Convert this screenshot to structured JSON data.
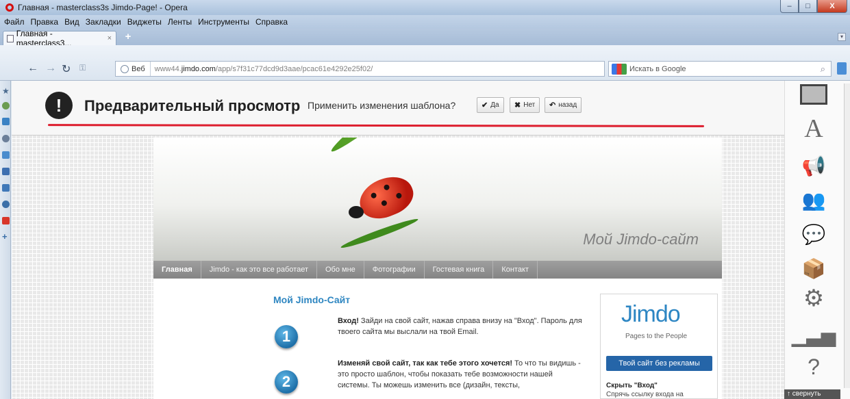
{
  "window": {
    "title": "Главная - masterclass3s Jimdo-Page! - Opera",
    "controls": [
      "–",
      "□",
      "X"
    ]
  },
  "menu": [
    "Файл",
    "Правка",
    "Вид",
    "Закладки",
    "Виджеты",
    "Ленты",
    "Инструменты",
    "Справка"
  ],
  "tab": {
    "label": "Главная - masterclass3...",
    "close": "×"
  },
  "address": {
    "web_label": "Веб",
    "url_prefix": "www44.",
    "url_domain": "jimdo.com",
    "url_path": "/app/s7f31c77dcd9d3aae/pcac61e4292e25f02/"
  },
  "search": {
    "placeholder": "Искать в Google"
  },
  "preview": {
    "title": "Предварительный просмотр",
    "question": "Применить изменения шаблона?",
    "yes": "Да",
    "no": "Нет",
    "back": "назад"
  },
  "site": {
    "title": "Мой Jimdo-сайт",
    "nav": [
      "Главная",
      "Jimdo - как это все работает",
      "Обо мне",
      "Фотографии",
      "Гостевая книга",
      "Контакт"
    ],
    "heading": "Мой Jimdo-Сайт",
    "step1_bold": "Вход!",
    "step1_text": " Зайди на свой сайт, нажав справа внизу на \"Вход\". Пароль для твоего сайта мы выслали на твой Email.",
    "step2_bold": "Изменяй свой сайт, так как тебе этого хочется!",
    "step2_text": " То что ты видишь - это просто шаблон, чтобы показать тебе возможности нашей системы. Ты можешь изменить все (дизайн, тексты,",
    "sidebox": {
      "logo": "Jimdo",
      "tagline": "Pages to the People",
      "button": "Твой сайт без рекламы",
      "hide_title": "Скрыть \"Вход\"",
      "hide_text": "Спрячь ссылку входа на"
    }
  },
  "panel": {
    "collapse": "свернуть",
    "icons": [
      "monitor-icon",
      "font-icon",
      "megaphone-icon",
      "users-icon",
      "chat-icon",
      "box-icon",
      "gear-icon",
      "stats-icon",
      "help-icon"
    ]
  }
}
